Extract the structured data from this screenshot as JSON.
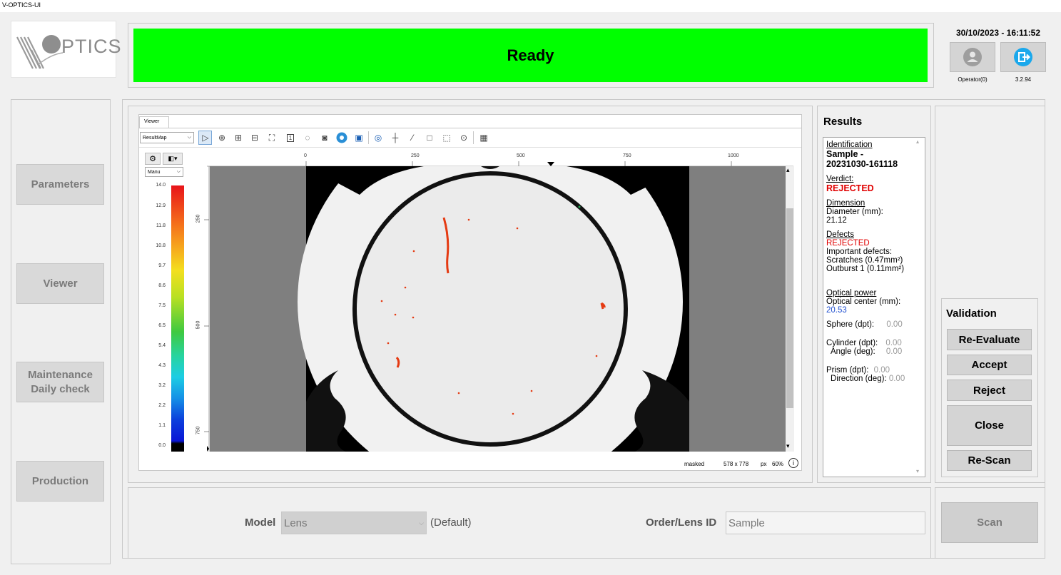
{
  "window": {
    "title": "V-OPTICS-UI"
  },
  "logo": {
    "text": "PTICS"
  },
  "status": {
    "text": "Ready",
    "color": "#00ff00"
  },
  "header": {
    "datetime": "30/10/2023 - 16:11:52",
    "operator_label": "Operator(0)",
    "version": "3.2.94"
  },
  "nav": {
    "parameters": "Parameters",
    "viewer": "Viewer",
    "maintenance_line1": "Maintenance",
    "maintenance_line2": "Daily check",
    "production": "Production"
  },
  "viewer": {
    "tab": "Viewer",
    "map_select": "ResultMap",
    "colorbar_mode": "Manu",
    "colorbar_ticks": [
      "14.0",
      "12.9",
      "11.8",
      "10.8",
      "9.7",
      "8.6",
      "7.5",
      "6.5",
      "5.4",
      "4.3",
      "3.2",
      "2.2",
      "1.1",
      "0.0"
    ],
    "h_ruler": [
      "0",
      "250",
      "500",
      "750",
      "1000"
    ],
    "v_ruler": [
      "250",
      "500",
      "750"
    ],
    "status_masked": "masked",
    "status_size": "578 x 778",
    "status_unit": "px",
    "status_zoom": "60%"
  },
  "results": {
    "title": "Results",
    "identification_label": "Identification",
    "identification_line1": "Sample -",
    "identification_line2": "20231030-161118",
    "verdict_label": "Verdict:",
    "verdict_value": "REJECTED",
    "dimension_label": "Dimension",
    "diameter_label": "Diameter (mm):",
    "diameter_value": "21.12",
    "defects_label": "Defects",
    "defects_verdict": "REJECTED",
    "important_defects": "Important defects:",
    "defect_1": "Scratches (0.47mm²)",
    "defect_2": "Outburst 1 (0.11mm²)",
    "optical_label": "Optical power",
    "optical_center_label": "Optical center (mm):",
    "optical_center_value": "20.53",
    "sphere_label": "Sphere (dpt):",
    "sphere_value": "0.00",
    "cylinder_label": "Cylinder (dpt):",
    "cylinder_value": "0.00",
    "angle_label": "Angle (deg):",
    "angle_value": "0.00",
    "prism_label": "Prism (dpt):",
    "prism_value": "0.00",
    "direction_label": "Direction (deg):",
    "direction_value": "0.00"
  },
  "validation": {
    "title": "Validation",
    "reevaluate": "Re-Evaluate",
    "accept": "Accept",
    "reject": "Reject",
    "close": "Close",
    "rescan": "Re-Scan"
  },
  "bottom": {
    "model_label": "Model",
    "model_value": "Lens",
    "model_default": "(Default)",
    "order_label": "Order/Lens ID",
    "order_value": "Sample",
    "scan": "Scan"
  }
}
